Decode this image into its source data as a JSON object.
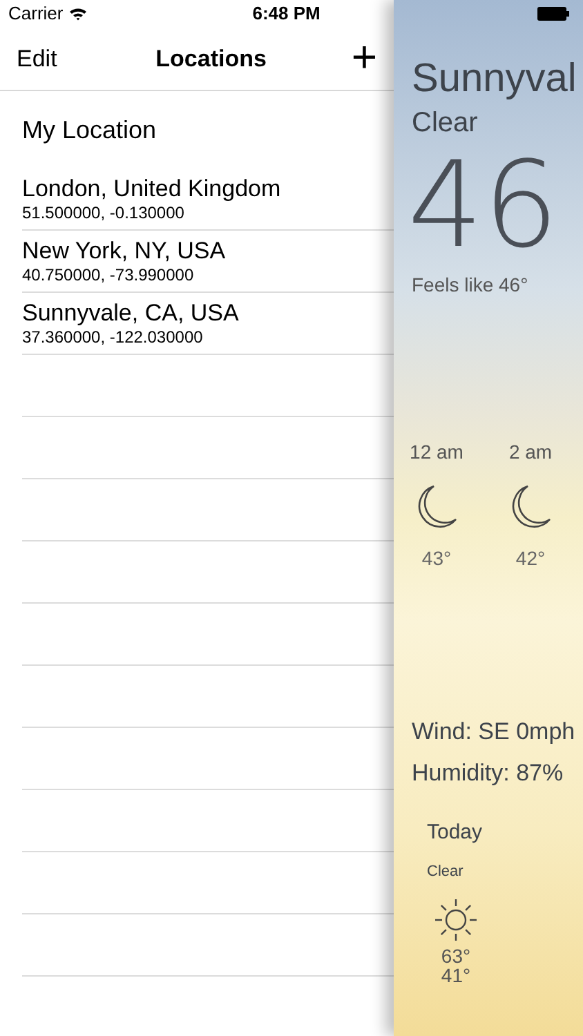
{
  "status_bar": {
    "carrier": "Carrier",
    "time": "6:48 PM"
  },
  "nav_bar": {
    "left_button": "Edit",
    "title": "Locations",
    "add_button": "+"
  },
  "locations": [
    {
      "kind": "current",
      "name": "My Location"
    },
    {
      "kind": "city",
      "name": "London, United Kingdom",
      "coords": "51.500000, -0.130000"
    },
    {
      "kind": "city",
      "name": "New York, NY, USA",
      "coords": "40.750000, -73.990000"
    },
    {
      "kind": "city",
      "name": "Sunnyvale, CA, USA",
      "coords": "37.360000, -122.030000"
    }
  ],
  "weather": {
    "city": "Sunnyval",
    "condition": "Clear",
    "temperature": "46",
    "feels_like": "Feels like 46°",
    "hourly": [
      {
        "time": "12 am",
        "kind": "night",
        "temp": "43°"
      },
      {
        "time": "2 am",
        "kind": "night",
        "temp": "42°"
      }
    ],
    "wind": "Wind: SE 0mph",
    "humidity": "Humidity: 87%",
    "daily": [
      {
        "day": "Today",
        "condition": "Clear",
        "kind": "clear",
        "high": "63°",
        "low": "41°"
      }
    ]
  }
}
